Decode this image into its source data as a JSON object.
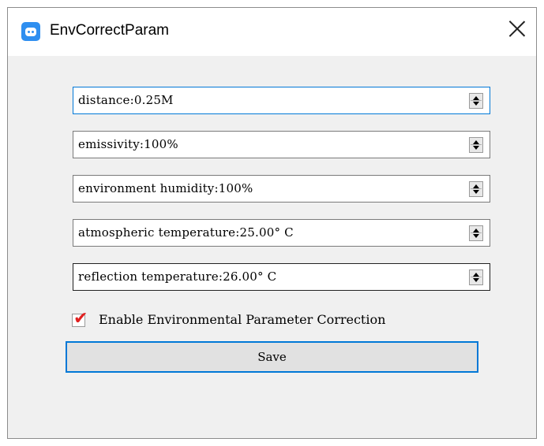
{
  "window": {
    "title": "EnvCorrectParam",
    "icon": "app-robot-icon",
    "close_icon": "close-icon"
  },
  "fields": [
    {
      "text": "distance:0.25M",
      "state": "focused"
    },
    {
      "text": "emissivity:100%"
    },
    {
      "text": "environment humidity:100%"
    },
    {
      "text": "atmospheric temperature:25.00° C"
    },
    {
      "text": "reflection temperature:26.00° C"
    }
  ],
  "checkbox": {
    "label": "Enable Environmental Parameter Correction",
    "checked": true,
    "mark_color": "#e02020"
  },
  "save_button": {
    "label": "Save"
  },
  "colors": {
    "accent": "#0078d7",
    "background": "#f0f0f0",
    "app_icon": "#2f8ff0"
  }
}
